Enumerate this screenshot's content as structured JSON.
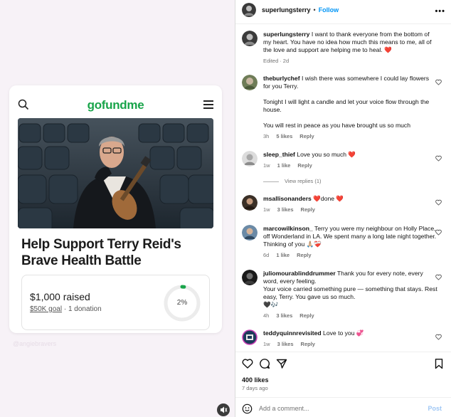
{
  "left": {
    "logo": "gofundme",
    "campaign_title": "Help Support Terry Reid's Brave Health Battle",
    "raised": "$1,000 raised",
    "goal": "$50K goal",
    "donations": "1 donation",
    "percent_label": "2%",
    "percent": 0.02,
    "watermark": "@angiebravers"
  },
  "header": {
    "username": "superlungsterry",
    "dot": "•",
    "follow": "Follow",
    "more": "•••"
  },
  "caption": {
    "username": "superlungsterry",
    "text": " I want to thank everyone from the bottom of my heart. You have no idea how much this means to me, all of the love and support are helping me to heal. ❤️",
    "edited": "Edited",
    "dot": "·",
    "time": "2d"
  },
  "comments": [
    {
      "username": "theburlychef",
      "text": " I wish there was somewhere I could lay flowers for you Terry.",
      "text2": "Tonight I will light a candle and let your voice flow through the house.",
      "text3": "You will rest in peace as you have brought us so much",
      "time": "3h",
      "likes": "5 likes",
      "reply": "Reply"
    },
    {
      "username": "sleep_thief",
      "text": " Love you so much ❤️",
      "time": "1w",
      "likes": "1 like",
      "reply": "Reply",
      "view_replies": "View replies (1)"
    },
    {
      "username": "msallisonanders",
      "text": " ❤️done ❤️",
      "time": "1w",
      "likes": "3 likes",
      "reply": "Reply"
    },
    {
      "username": "marcowilkinson_",
      "text": " Terry you were my neighbour on Holly Place, off Wonderland in LA. We spent many a long late night together. Thinking of you 🙏🏼❤️‍🩹",
      "time": "6d",
      "likes": "1 like",
      "reply": "Reply"
    },
    {
      "username": "juliomourablinddrummer",
      "text": " Thank you for every note, every word, every feeling.",
      "text2": "Your voice carried something pure — something that stays. Rest easy, Terry. You gave us so much.",
      "text3": "🖤🎶",
      "time": "4h",
      "likes": "3 likes",
      "reply": "Reply"
    },
    {
      "username": "teddyquinnrevisited",
      "text": " Love to you 💞",
      "time": "1w",
      "likes": "3 likes",
      "reply": "Reply"
    }
  ],
  "likes_count": "400 likes",
  "posted_ago": "7 days ago",
  "add_comment_placeholder": "Add a comment...",
  "post_label": "Post",
  "colors": {
    "accent": "#0095f6",
    "gofundme_green": "#19a44a",
    "muted": "#737373"
  }
}
